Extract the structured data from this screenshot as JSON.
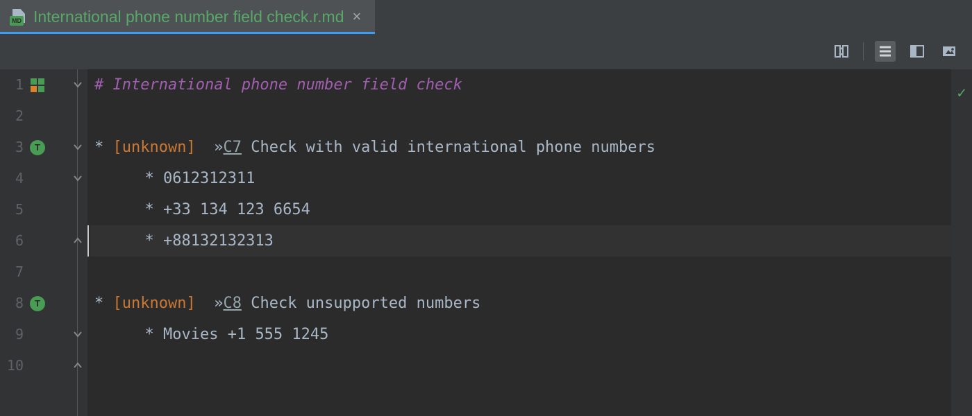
{
  "tab": {
    "title": "International phone number field check.r.md",
    "icon_badge": "MD"
  },
  "toolbar": {
    "scroll_sync": "scroll-sync",
    "editor_only": "editor-only",
    "split_view": "editor-and-preview",
    "preview_only": "preview-only"
  },
  "gutter": {
    "test_badge": "T"
  },
  "code": {
    "l1_prefix": "# ",
    "l1_heading": "International phone number field check",
    "l3_bullet": "* ",
    "l3_tag": "[unknown]",
    "l3_chev": "  »",
    "l3_link": "C7",
    "l3_rest": " Check with valid international phone numbers",
    "l4": "  * 0612312311",
    "l5": "  * +33 134 123 6654",
    "l6": "  * +88132132313",
    "l8_bullet": "* ",
    "l8_tag": "[unknown]",
    "l8_chev": "  »",
    "l8_link": "C8",
    "l8_rest": " Check unsupported numbers",
    "l9": "  * Movies +1 555 1245"
  },
  "line_numbers": [
    "1",
    "2",
    "3",
    "4",
    "5",
    "6",
    "7",
    "8",
    "9",
    "10"
  ],
  "status": {
    "ok": "✓"
  }
}
